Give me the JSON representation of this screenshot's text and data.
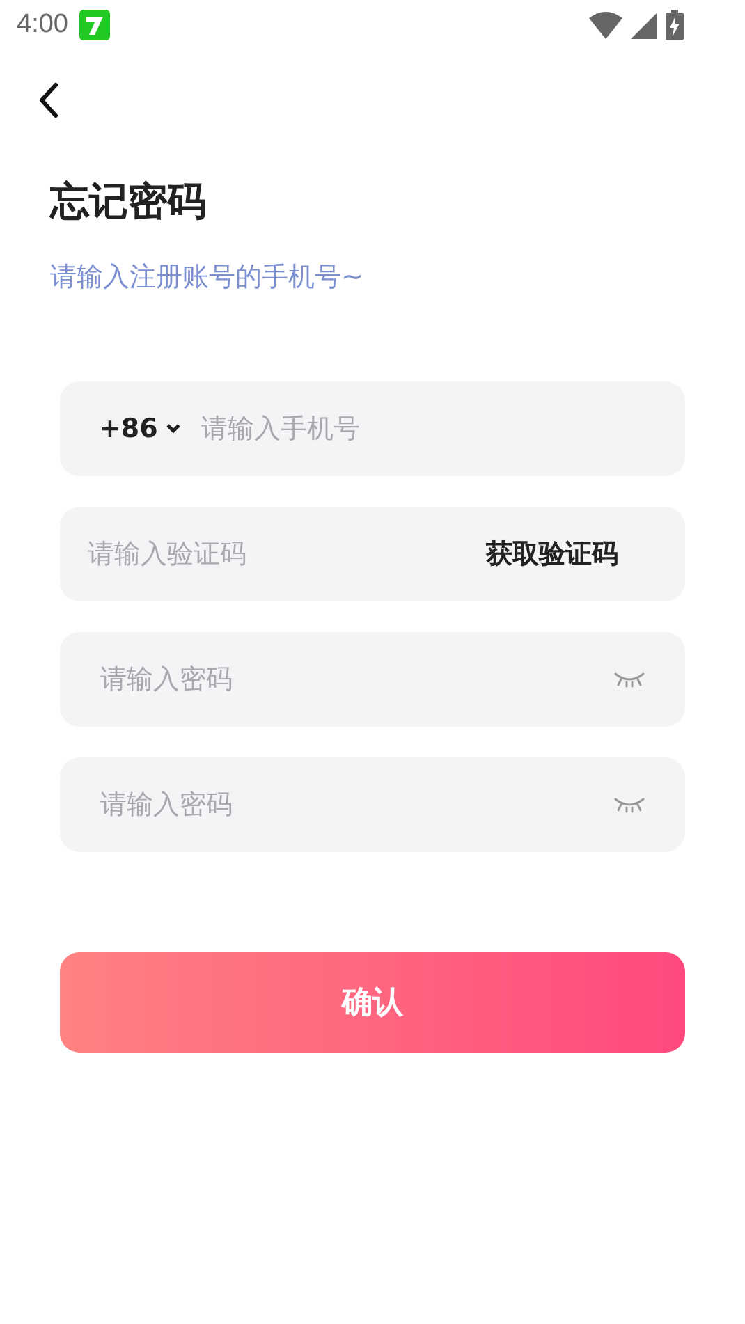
{
  "status_bar": {
    "time": "4:00"
  },
  "title": "忘记密码",
  "subtitle": "请输入注册账号的手机号~",
  "fields": [
    {
      "kind": "phone",
      "country_code": "+86",
      "placeholder": "请输入手机号"
    },
    {
      "kind": "code",
      "placeholder": "请输入验证码",
      "action": "获取验证码"
    },
    {
      "kind": "password",
      "placeholder": "请输入密码"
    },
    {
      "kind": "password",
      "placeholder": "请输入密码"
    }
  ],
  "confirm_button": "确认"
}
